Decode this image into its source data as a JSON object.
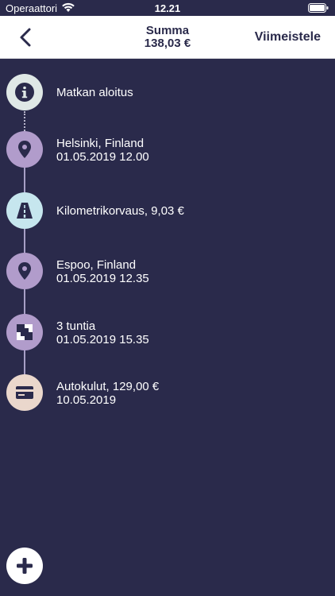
{
  "status": {
    "carrier": "Operaattori",
    "time": "12.21"
  },
  "nav": {
    "title": "Summa",
    "amount": "138,03 €",
    "finish_label": "Viimeistele"
  },
  "timeline": [
    {
      "icon": "info-icon",
      "line1": "Matkan aloitus",
      "line2": ""
    },
    {
      "icon": "location-pin-icon",
      "line1": "Helsinki, Finland",
      "line2": "01.05.2019 12.00"
    },
    {
      "icon": "road-icon",
      "line1": "Kilometrikorvaus, 9,03 €",
      "line2": ""
    },
    {
      "icon": "location-pin-icon",
      "line1": "Espoo, Finland",
      "line2": "01.05.2019 12.35"
    },
    {
      "icon": "checkered-flag-icon",
      "line1": "3 tuntia",
      "line2": "01.05.2019 15.35"
    },
    {
      "icon": "credit-card-icon",
      "line1": "Autokulut, 129,00 €",
      "line2": "10.05.2019"
    }
  ],
  "colors": {
    "background": "#2a2a4b",
    "header": "#ffffff",
    "accent_purple": "#b19ccb"
  }
}
